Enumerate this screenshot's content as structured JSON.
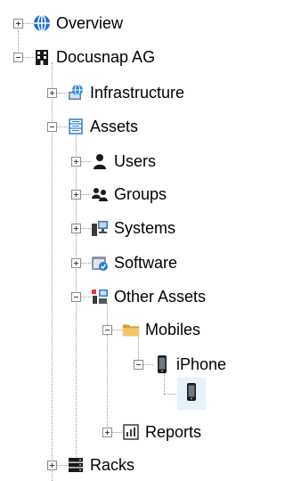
{
  "tree": {
    "nodes": [
      {
        "label": "Overview",
        "icon": "globe-icon",
        "expander": "plus"
      },
      {
        "label": "Docusnap AG",
        "icon": "building-icon",
        "expander": "minus"
      },
      {
        "label": "Infrastructure",
        "icon": "network-icon",
        "expander": "plus"
      },
      {
        "label": "Assets",
        "icon": "assets-icon",
        "expander": "minus"
      },
      {
        "label": "Users",
        "icon": "user-icon",
        "expander": "plus"
      },
      {
        "label": "Groups",
        "icon": "group-icon",
        "expander": "plus"
      },
      {
        "label": "Systems",
        "icon": "systems-icon",
        "expander": "plus"
      },
      {
        "label": "Software",
        "icon": "software-icon",
        "expander": "plus"
      },
      {
        "label": "Other Assets",
        "icon": "other-assets-icon",
        "expander": "minus"
      },
      {
        "label": "Mobiles",
        "icon": "folder-icon",
        "expander": "minus"
      },
      {
        "label": "iPhone",
        "icon": "phone-icon",
        "expander": "minus"
      },
      {
        "label": "",
        "icon": "phone-icon",
        "expander": "none"
      },
      {
        "label": "Reports",
        "icon": "report-icon",
        "expander": "plus"
      },
      {
        "label": "Racks",
        "icon": "rack-icon",
        "expander": "plus"
      }
    ]
  },
  "colors": {
    "globe": "#1e6fd9",
    "assets": "#2a7bd6",
    "folder": "#e8b04a",
    "selection": "#e5f1fb",
    "connector": "#9a9a9a",
    "accent_red": "#e23b2e"
  }
}
